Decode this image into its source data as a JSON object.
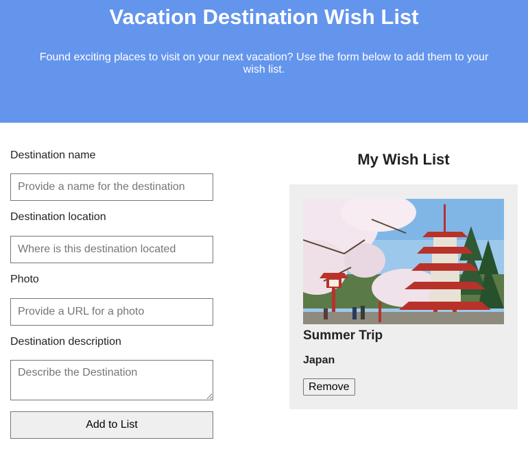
{
  "header": {
    "title": "Vacation Destination Wish List",
    "subtitle": "Found exciting places to visit on your next vacation? Use the form below to add them to your wish list."
  },
  "form": {
    "name_label": "Destination name",
    "name_value": "",
    "name_placeholder": "Provide a name for the destination",
    "location_label": "Destination location",
    "location_value": "",
    "location_placeholder": "Where is this destination located",
    "photo_label": "Photo",
    "photo_value": "",
    "photo_placeholder": "Provide a URL for a photo",
    "description_label": "Destination description",
    "description_value": "",
    "description_placeholder": "Describe the Destination",
    "submit_label": "Add to List"
  },
  "wishlist": {
    "heading": "My Wish List",
    "cards": [
      {
        "title": "Summer Trip",
        "location": "Japan",
        "remove_label": "Remove",
        "photo_icon": "pagoda-cherry-blossom-photo"
      }
    ]
  },
  "colors": {
    "header_bg": "#6495ed",
    "header_text": "#ffffff",
    "card_bg": "#eeeeee",
    "button_bg": "#efefef"
  }
}
